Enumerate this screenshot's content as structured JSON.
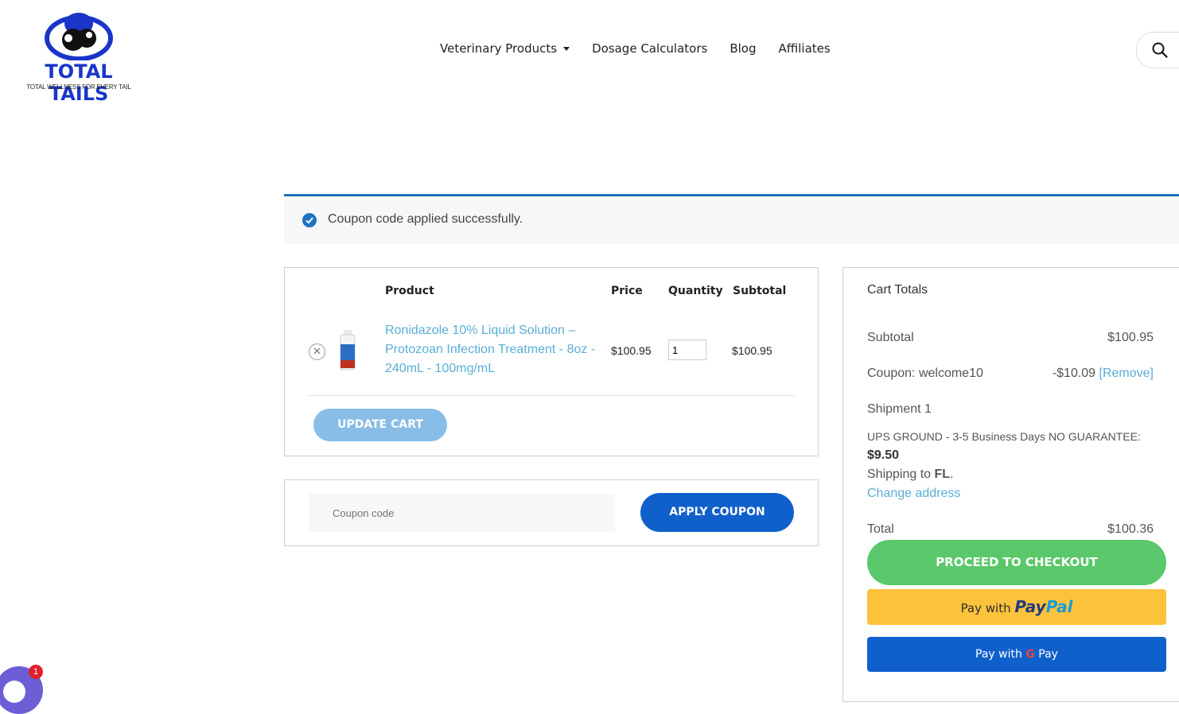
{
  "brand": {
    "name": "TOTAL TAILS",
    "tagline": "TOTAL WELLNESS FOR EVERY TAIL"
  },
  "nav": {
    "items": [
      {
        "label": "Veterinary Products",
        "has_dropdown": true,
        "icon": "caret-down-icon"
      },
      {
        "label": "Dosage Calculators"
      },
      {
        "label": "Blog"
      },
      {
        "label": "Affiliates"
      }
    ],
    "search_icon": "search-icon"
  },
  "notice": {
    "message": "Coupon code applied successfully.",
    "icon": "check-circle-icon",
    "color": "#1e73be"
  },
  "cart": {
    "headers": {
      "product": "Product",
      "price": "Price",
      "quantity": "Quantity",
      "subtotal": "Subtotal"
    },
    "items": [
      {
        "name": "Ronidazole 10% Liquid Solution – Protozoan Infection Treatment - 8oz - 240mL - 100mg/mL",
        "price": "$100.95",
        "quantity": "1",
        "subtotal": "$100.95",
        "remove_icon": "close-circle-icon"
      }
    ],
    "update_label": "UPDATE CART"
  },
  "coupon": {
    "placeholder": "Coupon code",
    "apply_label": "APPLY COUPON"
  },
  "totals": {
    "title": "Cart Totals",
    "subtotal_label": "Subtotal",
    "subtotal_value": "$100.95",
    "coupon_label": "Coupon: welcome10",
    "coupon_value": "-$10.09",
    "coupon_remove": "[Remove]",
    "shipment_label": "Shipment 1",
    "shipping_method": "UPS GROUND - 3-5 Business Days NO GUARANTEE:",
    "shipping_cost": "$9.50",
    "shipping_to_prefix": "Shipping to",
    "shipping_to_state": "FL",
    "change_address": "Change address",
    "total_label": "Total",
    "total_value": "$100.36",
    "checkout_label": "PROCEED TO CHECKOUT",
    "paypal": {
      "prefix": "Pay with",
      "brand_a": "Pay",
      "brand_b": "Pal"
    },
    "gpay": {
      "prefix": "Pay with",
      "g": "G",
      "pay": "Pay"
    }
  },
  "chat": {
    "badge_count": "1",
    "icon": "chat-icon"
  },
  "colors": {
    "accent_blue": "#1060cc",
    "link": "#5aaed6",
    "checkout_green": "#5ac86a",
    "paypal_yellow": "#fcc23b"
  }
}
